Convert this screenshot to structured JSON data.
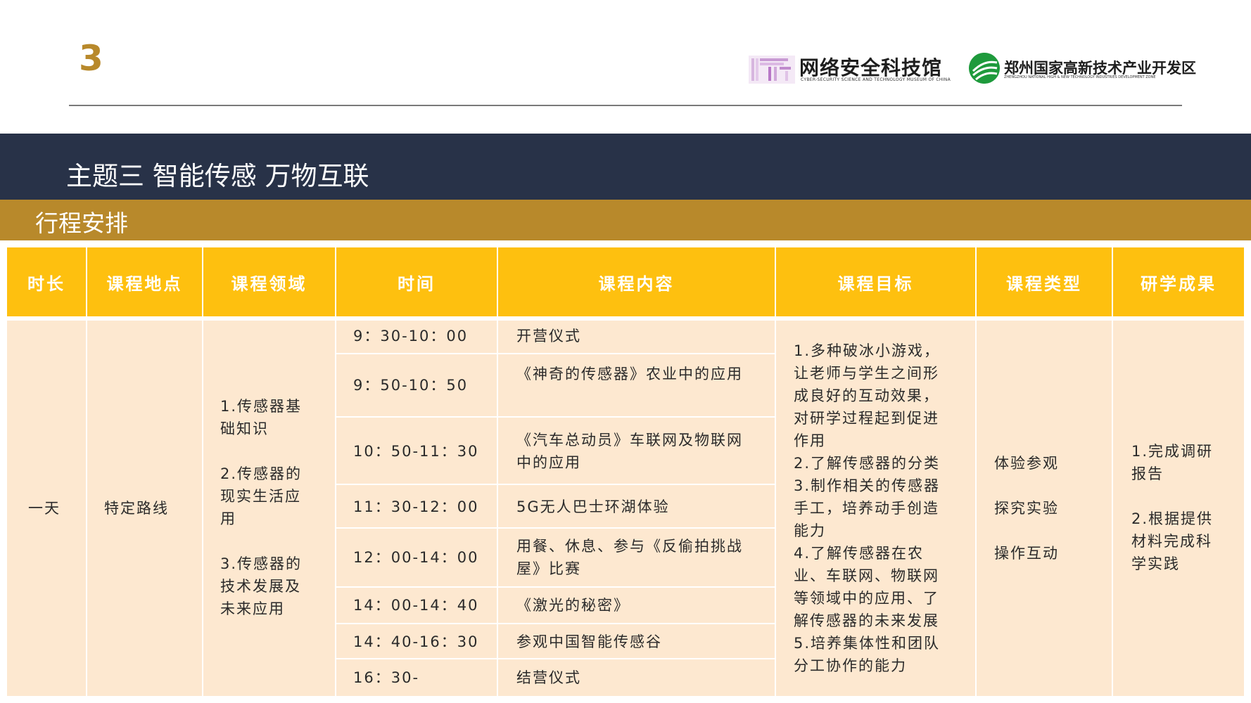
{
  "page_number": "3",
  "logos": {
    "museum_name": "网络安全科技馆",
    "museum_sub": "CYBER-SECURITY SCIENCE AND TECHNOLOGY MUSEUM OF CHINA",
    "zone_name": "郑州国家高新技术产业开发区",
    "zone_sub": "ZHENGZHOU NATIONAL HIGH & NEW TECHNOLOGY INDUSTRIES DEVELOPMENT ZONE"
  },
  "theme_title": "主题三 智能传感 万物互联",
  "itinerary_title": "行程安排",
  "headers": [
    "时长",
    "课程地点",
    "课程领域",
    "时间",
    "课程内容",
    "课程目标",
    "课程类型",
    "研学成果"
  ],
  "duration": "一天",
  "location": "特定路线",
  "domain": [
    "1.传感器基础知识",
    "2.传感器的现实生活应用",
    "3.传感器的技术发展及未来应用"
  ],
  "schedule": [
    {
      "time": "9：30-10：00",
      "content": "开营仪式"
    },
    {
      "time": "9：50-10：50",
      "content": "《神奇的传感器》农业中的应用"
    },
    {
      "time": "10：50-11：30",
      "content": "《汽车总动员》车联网及物联网中的应用"
    },
    {
      "time": "11：30-12：00",
      "content": "5G无人巴士环湖体验"
    },
    {
      "time": "12：00-14：00",
      "content": "用餐、休息、参与《反偷拍挑战屋》比赛"
    },
    {
      "time": "14：00-14：40",
      "content": "《激光的秘密》"
    },
    {
      "time": "14：40-16：30",
      "content": "参观中国智能传感谷"
    },
    {
      "time": "16：30-",
      "content": "结营仪式"
    }
  ],
  "goals": [
    "1.多种破冰小游戏，让老师与学生之间形成良好的互动效果，对研学过程起到促进作用",
    "2.了解传感器的分类",
    "3.制作相关的传感器手工，培养动手创造能力",
    "4.了解传感器在农业、车联网、物联网等领域中的应用、了解传感器的未来发展",
    "5.培养集体性和团队分工协作的能力"
  ],
  "course_types": [
    "体验参观",
    "探究实验",
    "操作互动"
  ],
  "outcomes": [
    "1.完成调研报告",
    "2.根据提供材料完成科学实践"
  ],
  "colors": {
    "gold": "#b8892b",
    "navy": "#283248",
    "header_yellow": "#fec00f",
    "cell_peach": "#fde8d0"
  }
}
